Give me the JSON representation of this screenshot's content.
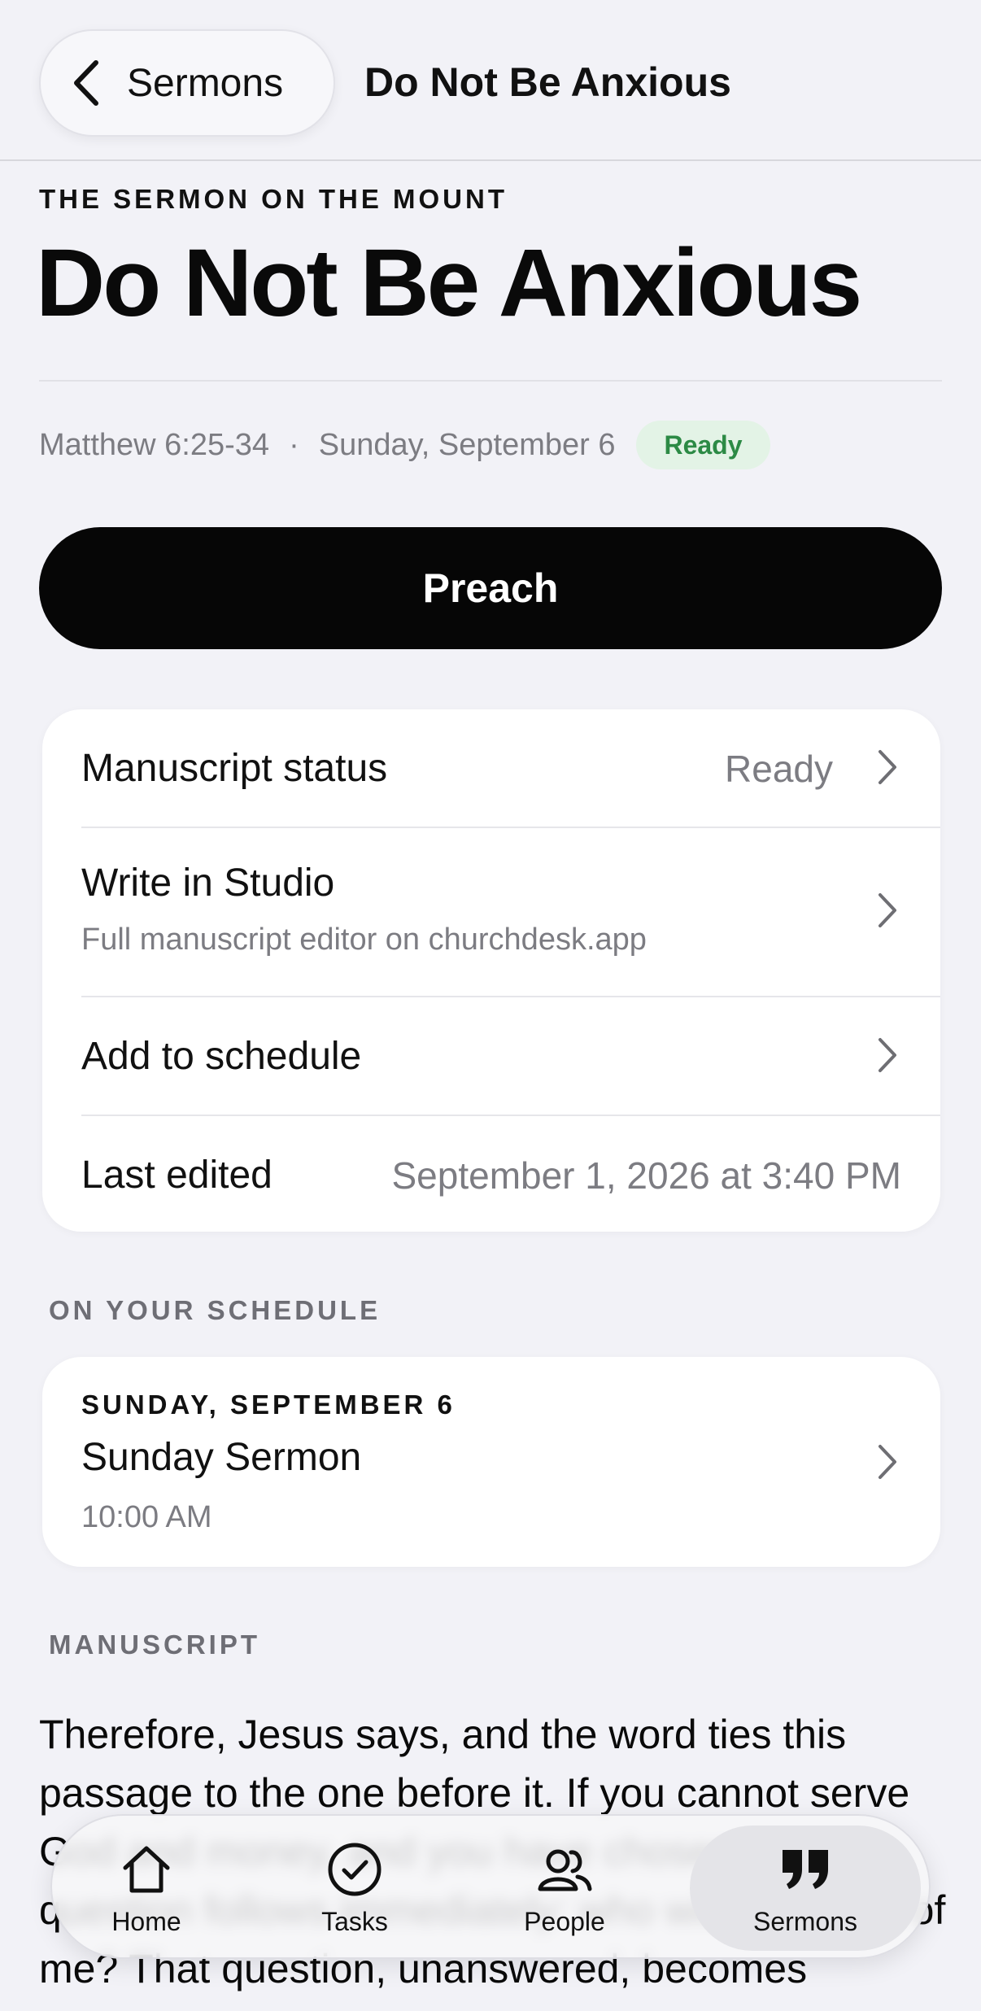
{
  "nav": {
    "back_label": "Sermons",
    "title": "Do Not Be Anxious"
  },
  "header": {
    "series": "THE SERMON ON THE MOUNT",
    "title": "Do Not Be Anxious",
    "scripture": "Matthew 6:25-34",
    "separator": "·",
    "date": "Sunday, September 6",
    "status_badge": "Ready",
    "status_color": "#2c8a45"
  },
  "preach_label": "Preach",
  "details": {
    "manuscript_status_label": "Manuscript status",
    "manuscript_status_value": "Ready",
    "studio_label": "Write in Studio",
    "studio_sub": "Full manuscript editor on churchdesk.app",
    "schedule_label": "Add to schedule",
    "last_edited_label": "Last edited",
    "last_edited_value": "September 1, 2026 at 3:40 PM"
  },
  "schedule": {
    "section_label": "ON YOUR SCHEDULE",
    "date": "SUNDAY, SEPTEMBER 6",
    "title": "Sunday Sermon",
    "time": "10:00 AM"
  },
  "manuscript": {
    "section_label": "MANUSCRIPT",
    "text": "Therefore, Jesus says, and the word ties this passage to the one before it. If you cannot serve God and money, and you have chosen God, a question follows immediately: who will take care of me? That question, unanswered, becomes"
  },
  "tabs": [
    {
      "label": "Home",
      "icon": "house-icon"
    },
    {
      "label": "Tasks",
      "icon": "checkmark-circle-icon"
    },
    {
      "label": "People",
      "icon": "people-icon"
    },
    {
      "label": "Sermons",
      "icon": "quote-icon",
      "active": true
    }
  ]
}
